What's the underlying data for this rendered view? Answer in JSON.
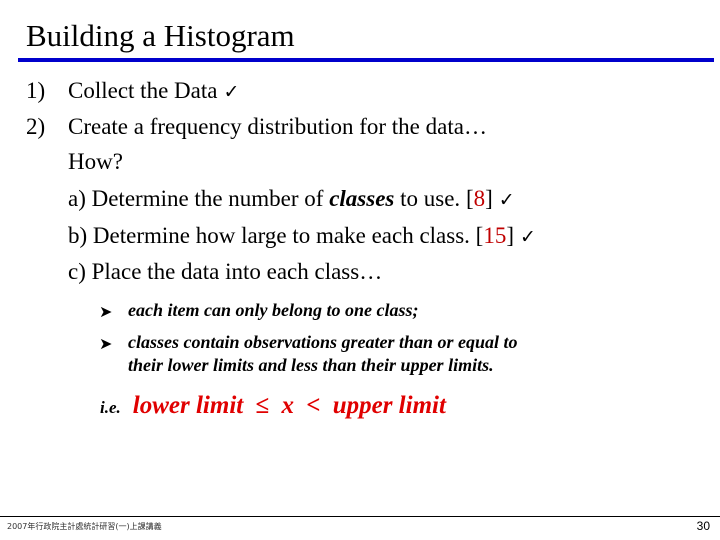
{
  "slide": {
    "title": "Building a Histogram",
    "accent_color": "#0000cc",
    "steps": [
      {
        "number": "1)",
        "text": "Collect the Data",
        "check": "✓"
      },
      {
        "number": "2)",
        "text": "Create a frequency distribution for the data…"
      }
    ],
    "how_label": "How?",
    "substeps": [
      {
        "pre": "a) Determine the number of ",
        "emph": "classes",
        "post": " to use. ",
        "bracket_open": "[",
        "value": "8",
        "bracket_close": "]",
        "check": "✓"
      },
      {
        "pre": "b) Determine how large to make each class. ",
        "bracket_open": "[",
        "value": "15",
        "bracket_close": "]",
        "check": "✓"
      },
      {
        "pre": "c) Place the data into each class…"
      }
    ],
    "bullets": [
      {
        "icon": "arrow-bullet-icon",
        "glyph": "➤",
        "text": "each item can only belong to one class;"
      },
      {
        "icon": "arrow-bullet-icon",
        "glyph": "➤",
        "text_line1": "classes contain observations greater than or equal to",
        "text_line2": "their lower limits and less than their upper limits."
      }
    ],
    "ie": {
      "label": "i.e.",
      "lhs": "lower limit",
      "op1": "≤",
      "var": "x",
      "op2": "<",
      "rhs": "upper limit",
      "color": "#e00000"
    }
  },
  "footer": {
    "left_text": "2007年行政院主計處統計研習(一)上課講義",
    "page_number": "30"
  }
}
